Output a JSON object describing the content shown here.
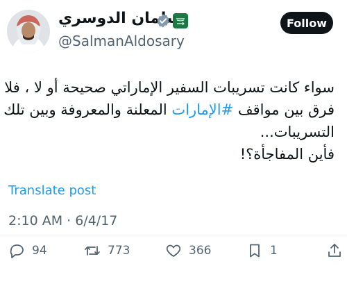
{
  "profile": {
    "display_name": "سلمان الدوسري",
    "handle": "@SalmanAldosary",
    "verified_color": "#829aab",
    "follow_label": "Follow"
  },
  "tweet": {
    "line1": "سواء كانت تسريبات السفير الإماراتي صحيحة أو لا ، فلا",
    "line2_before": "فرق بين مواقف ",
    "line2_hashtag": "#الإمارات",
    "line2_after": " المعلنة والمعروفة وبين تلك",
    "line3": "التسريبات...",
    "line4": "فأين المفاجأة؟!",
    "hashtag_color": "#1d9bf0"
  },
  "translate_label": "Translate post",
  "timestamp": "2:10 AM · 6/4/17",
  "actions": {
    "replies": "94",
    "reposts": "773",
    "likes": "366",
    "bookmarks": "1"
  },
  "icons": {
    "reply": "reply-icon",
    "repost": "repost-icon",
    "like": "heart-icon",
    "bookmark": "bookmark-icon",
    "share": "share-icon"
  }
}
